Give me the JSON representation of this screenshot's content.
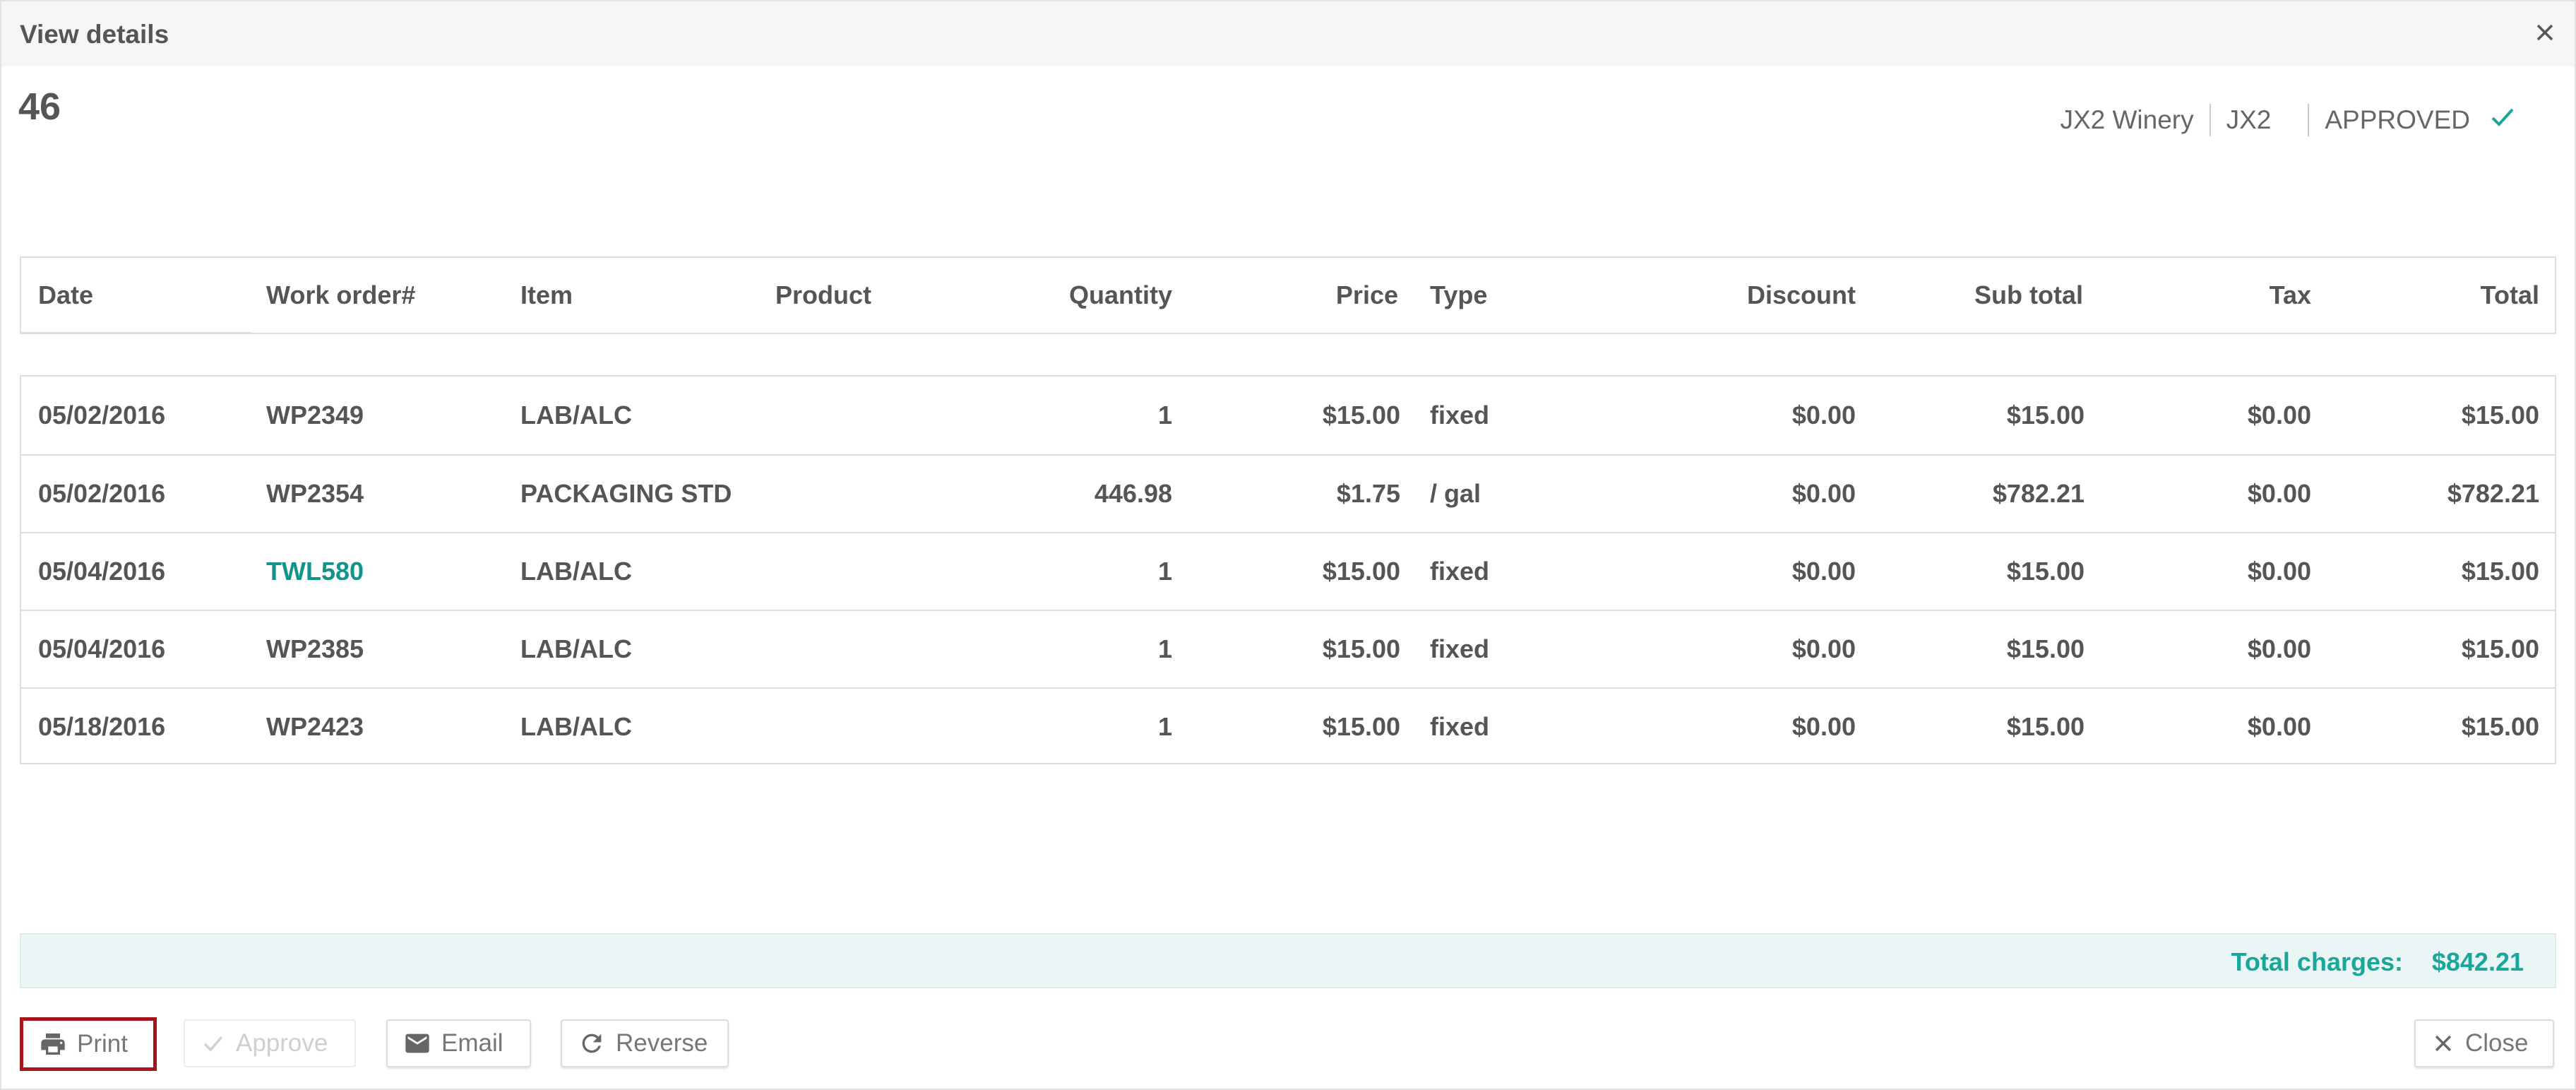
{
  "dialog": {
    "title": "View details",
    "close_icon": "close-icon"
  },
  "header": {
    "number": "46",
    "winery": "JX2 Winery",
    "code": "JX2",
    "status": "APPROVED",
    "status_icon": "check-icon",
    "status_color": "#1aa79a"
  },
  "table": {
    "columns": [
      "Date",
      "Work order#",
      "Item",
      "Product",
      "Quantity",
      "Price",
      "Type",
      "Discount",
      "Sub total",
      "Tax",
      "Total"
    ],
    "rows": [
      {
        "date": "05/02/2016",
        "work_order": "WP2349",
        "item": "LAB/ALC",
        "product": "",
        "quantity": "1",
        "price": "$15.00",
        "type": "fixed",
        "discount": "$0.00",
        "subtotal": "$15.00",
        "tax": "$0.00",
        "total": "$15.00"
      },
      {
        "date": "05/02/2016",
        "work_order": "WP2354",
        "item": "PACKAGING STD",
        "product": "",
        "quantity": "446.98",
        "price": "$1.75",
        "type": "/ gal",
        "discount": "$0.00",
        "subtotal": "$782.21",
        "tax": "$0.00",
        "total": "$782.21"
      },
      {
        "date": "05/04/2016",
        "work_order": "TWL580",
        "item": "LAB/ALC",
        "product": "",
        "quantity": "1",
        "price": "$15.00",
        "type": "fixed",
        "discount": "$0.00",
        "subtotal": "$15.00",
        "tax": "$0.00",
        "total": "$15.00"
      },
      {
        "date": "05/04/2016",
        "work_order": "WP2385",
        "item": "LAB/ALC",
        "product": "",
        "quantity": "1",
        "price": "$15.00",
        "type": "fixed",
        "discount": "$0.00",
        "subtotal": "$15.00",
        "tax": "$0.00",
        "total": "$15.00"
      },
      {
        "date": "05/18/2016",
        "work_order": "WP2423",
        "item": "LAB/ALC",
        "product": "",
        "quantity": "1",
        "price": "$15.00",
        "type": "fixed",
        "discount": "$0.00",
        "subtotal": "$15.00",
        "tax": "$0.00",
        "total": "$15.00"
      }
    ]
  },
  "summary": {
    "total_label": "Total charges:",
    "total_value": "$842.21"
  },
  "footer": {
    "print_label": "Print",
    "approve_label": "Approve",
    "email_label": "Email",
    "reverse_label": "Reverse",
    "close_label": "Close"
  },
  "colors": {
    "accent": "#1aa79a",
    "link": "#13948a",
    "highlight_border": "#a4151c"
  }
}
